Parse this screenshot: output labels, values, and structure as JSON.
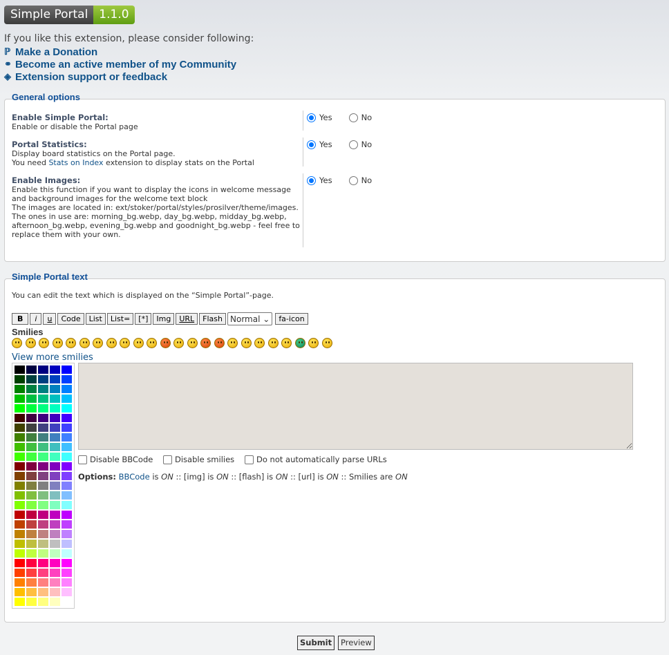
{
  "header": {
    "name": "Simple Portal",
    "version": "1.1.0"
  },
  "intro": "If you like this extension, please consider following:",
  "links": [
    {
      "icon": "paypal-icon",
      "label": "Make a Donation"
    },
    {
      "icon": "link-icon",
      "label": "Become an active member of my Community"
    },
    {
      "icon": "tag-icon",
      "label": "Extension support or feedback"
    }
  ],
  "general": {
    "legend": "General options",
    "options": [
      {
        "label": "Enable Simple Portal:",
        "desc": [
          "Enable or disable the Portal page"
        ],
        "value": "Yes"
      },
      {
        "label": "Portal Statistics:",
        "desc": [
          "Display board statistics on the Portal page.",
          "You need ",
          "Stats on Index",
          " extension to display stats on the Portal"
        ],
        "value": "Yes"
      },
      {
        "label": "Enable Images:",
        "desc": [
          "Enable this function if you want to display the icons in welcome message and background images for the welcome text block",
          "The images are located in: ext/stoker/portal/styles/prosilver/theme/images. The ones in use are: morning_bg.webp, day_bg.webp, midday_bg.webp, afternoon_bg.webp, evening_bg.webp and goodnight_bg.webp - feel free to replace them with your own."
        ],
        "value": "Yes"
      }
    ],
    "yes": "Yes",
    "no": "No"
  },
  "text_panel": {
    "legend": "Simple Portal text",
    "explain": "You can edit the text which is displayed on the “Simple Portal”-page.",
    "buttons": [
      "B",
      "i",
      "u",
      "Code",
      "List",
      "List=",
      "[*]",
      "Img",
      "URL",
      "Flash"
    ],
    "font_size": "Normal",
    "fa_icon": "fa-icon",
    "smilies_title": "Smilies",
    "view_more": "View more smilies",
    "editor_value": "",
    "checkboxes": [
      "Disable BBCode",
      "Disable smilies",
      "Do not automatically parse URLs"
    ],
    "options_label": "Options:",
    "bbcode": "BBCode",
    "is": "is",
    "on": "ON",
    "img": "[img]",
    "flash": "[flash]",
    "url": "[url]",
    "smilies_are": "Smilies are",
    "sep": "::"
  },
  "footer": {
    "submit": "Submit",
    "preview": "Preview"
  }
}
